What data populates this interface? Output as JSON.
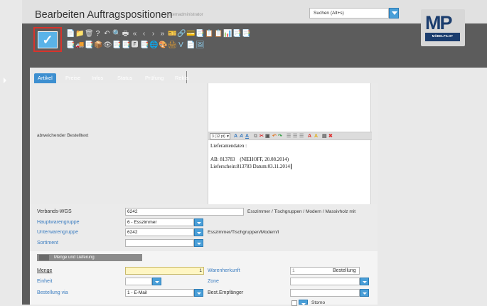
{
  "window": {
    "title": "Bearbeiten Auftragspositionen",
    "subtitle": "Systemadministrator",
    "search_placeholder": "Suchen (Alt+s)",
    "logo_text": "MP",
    "logo_band": "MÖBELPILOT"
  },
  "toolbar": {
    "save_glyph": "✓",
    "row1": [
      "📄",
      "📁",
      "🗑",
      "?",
      "↶",
      "🔍",
      "🖶",
      "«",
      "‹",
      "›",
      "»",
      "🎫",
      "🔗",
      "💳",
      "📑",
      "📋",
      "📋",
      "📊",
      "📑",
      "📑"
    ],
    "row2": [
      "📑",
      "🚚",
      "📑",
      "📦",
      "👁",
      "📑",
      "📑",
      "🅵",
      "📑",
      "🌐",
      "🎨",
      "🖨",
      "V",
      "📄",
      "🖼"
    ]
  },
  "tabs": [
    {
      "label": "Artikel",
      "active": true
    },
    {
      "label": "Preise",
      "active": false
    },
    {
      "label": "Infos",
      "active": false
    },
    {
      "label": "Status",
      "active": false
    },
    {
      "label": "Prüfung",
      "active": false
    },
    {
      "label": "Rekla",
      "active": false
    }
  ],
  "editor": {
    "label": "abweichender Bestelltext",
    "font_size": "3 (12 pt) ▼",
    "text_lines": [
      "Lieferantendaten :",
      "",
      "AB: 813783    (NIEHOFF, 20.08.2014)",
      "Lieferschein:813783 Datum:03.11.2014"
    ]
  },
  "fields": {
    "verbands_wgs": {
      "label": "Verbands-WGS",
      "value": "6242",
      "desc": "Esszimmer / Tischgruppen / Modern / Massivholz mit"
    },
    "hauptwarengruppe": {
      "label": "Hauptwarengruppe",
      "value": "6 - Esszimmer"
    },
    "unterwarengruppe": {
      "label": "Unterwarengruppe",
      "value": "6242",
      "desc": "Esszimmer/Tischgruppen/Modern/I"
    },
    "sortiment": {
      "label": "Sortiment",
      "value": ""
    }
  },
  "section": {
    "title": "Menge und Lieferung",
    "menge": {
      "label": "Menge",
      "value": "1"
    },
    "einheit": {
      "label": "Einheit",
      "value": ""
    },
    "bestellung_via": {
      "label": "Bestellung via",
      "value": "1 - E-Mail"
    },
    "warenherkunft": {
      "label": "Warenherkunft",
      "value": "1",
      "desc": "Bestellung"
    },
    "zone": {
      "label": "Zone",
      "value": ""
    },
    "best_empfaenger": {
      "label": "Best.Empfänger",
      "value": ""
    },
    "storno": {
      "label": "Storno"
    }
  }
}
